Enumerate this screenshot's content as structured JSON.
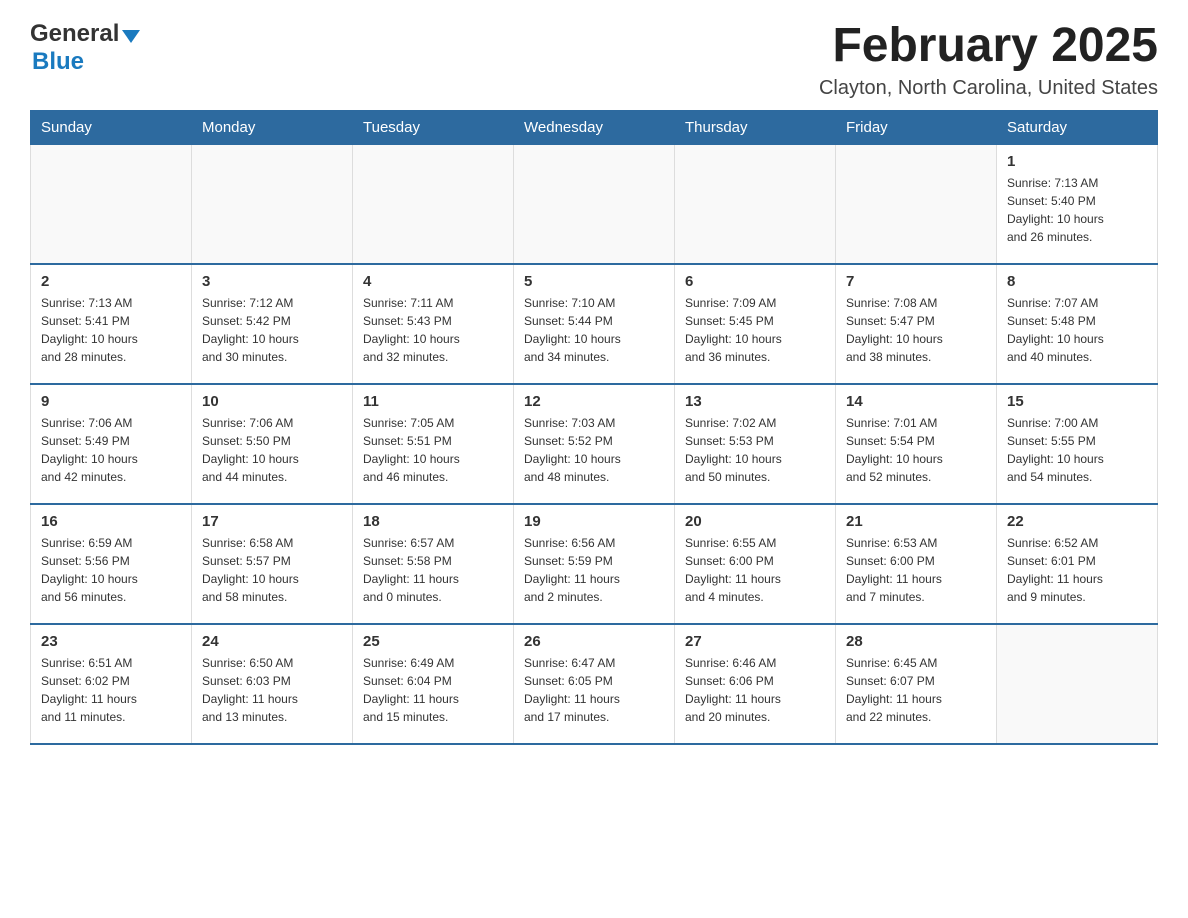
{
  "logo": {
    "general": "General",
    "blue": "Blue"
  },
  "header": {
    "month_title": "February 2025",
    "location": "Clayton, North Carolina, United States"
  },
  "weekdays": [
    "Sunday",
    "Monday",
    "Tuesday",
    "Wednesday",
    "Thursday",
    "Friday",
    "Saturday"
  ],
  "weeks": [
    [
      {
        "day": "",
        "info": ""
      },
      {
        "day": "",
        "info": ""
      },
      {
        "day": "",
        "info": ""
      },
      {
        "day": "",
        "info": ""
      },
      {
        "day": "",
        "info": ""
      },
      {
        "day": "",
        "info": ""
      },
      {
        "day": "1",
        "info": "Sunrise: 7:13 AM\nSunset: 5:40 PM\nDaylight: 10 hours\nand 26 minutes."
      }
    ],
    [
      {
        "day": "2",
        "info": "Sunrise: 7:13 AM\nSunset: 5:41 PM\nDaylight: 10 hours\nand 28 minutes."
      },
      {
        "day": "3",
        "info": "Sunrise: 7:12 AM\nSunset: 5:42 PM\nDaylight: 10 hours\nand 30 minutes."
      },
      {
        "day": "4",
        "info": "Sunrise: 7:11 AM\nSunset: 5:43 PM\nDaylight: 10 hours\nand 32 minutes."
      },
      {
        "day": "5",
        "info": "Sunrise: 7:10 AM\nSunset: 5:44 PM\nDaylight: 10 hours\nand 34 minutes."
      },
      {
        "day": "6",
        "info": "Sunrise: 7:09 AM\nSunset: 5:45 PM\nDaylight: 10 hours\nand 36 minutes."
      },
      {
        "day": "7",
        "info": "Sunrise: 7:08 AM\nSunset: 5:47 PM\nDaylight: 10 hours\nand 38 minutes."
      },
      {
        "day": "8",
        "info": "Sunrise: 7:07 AM\nSunset: 5:48 PM\nDaylight: 10 hours\nand 40 minutes."
      }
    ],
    [
      {
        "day": "9",
        "info": "Sunrise: 7:06 AM\nSunset: 5:49 PM\nDaylight: 10 hours\nand 42 minutes."
      },
      {
        "day": "10",
        "info": "Sunrise: 7:06 AM\nSunset: 5:50 PM\nDaylight: 10 hours\nand 44 minutes."
      },
      {
        "day": "11",
        "info": "Sunrise: 7:05 AM\nSunset: 5:51 PM\nDaylight: 10 hours\nand 46 minutes."
      },
      {
        "day": "12",
        "info": "Sunrise: 7:03 AM\nSunset: 5:52 PM\nDaylight: 10 hours\nand 48 minutes."
      },
      {
        "day": "13",
        "info": "Sunrise: 7:02 AM\nSunset: 5:53 PM\nDaylight: 10 hours\nand 50 minutes."
      },
      {
        "day": "14",
        "info": "Sunrise: 7:01 AM\nSunset: 5:54 PM\nDaylight: 10 hours\nand 52 minutes."
      },
      {
        "day": "15",
        "info": "Sunrise: 7:00 AM\nSunset: 5:55 PM\nDaylight: 10 hours\nand 54 minutes."
      }
    ],
    [
      {
        "day": "16",
        "info": "Sunrise: 6:59 AM\nSunset: 5:56 PM\nDaylight: 10 hours\nand 56 minutes."
      },
      {
        "day": "17",
        "info": "Sunrise: 6:58 AM\nSunset: 5:57 PM\nDaylight: 10 hours\nand 58 minutes."
      },
      {
        "day": "18",
        "info": "Sunrise: 6:57 AM\nSunset: 5:58 PM\nDaylight: 11 hours\nand 0 minutes."
      },
      {
        "day": "19",
        "info": "Sunrise: 6:56 AM\nSunset: 5:59 PM\nDaylight: 11 hours\nand 2 minutes."
      },
      {
        "day": "20",
        "info": "Sunrise: 6:55 AM\nSunset: 6:00 PM\nDaylight: 11 hours\nand 4 minutes."
      },
      {
        "day": "21",
        "info": "Sunrise: 6:53 AM\nSunset: 6:00 PM\nDaylight: 11 hours\nand 7 minutes."
      },
      {
        "day": "22",
        "info": "Sunrise: 6:52 AM\nSunset: 6:01 PM\nDaylight: 11 hours\nand 9 minutes."
      }
    ],
    [
      {
        "day": "23",
        "info": "Sunrise: 6:51 AM\nSunset: 6:02 PM\nDaylight: 11 hours\nand 11 minutes."
      },
      {
        "day": "24",
        "info": "Sunrise: 6:50 AM\nSunset: 6:03 PM\nDaylight: 11 hours\nand 13 minutes."
      },
      {
        "day": "25",
        "info": "Sunrise: 6:49 AM\nSunset: 6:04 PM\nDaylight: 11 hours\nand 15 minutes."
      },
      {
        "day": "26",
        "info": "Sunrise: 6:47 AM\nSunset: 6:05 PM\nDaylight: 11 hours\nand 17 minutes."
      },
      {
        "day": "27",
        "info": "Sunrise: 6:46 AM\nSunset: 6:06 PM\nDaylight: 11 hours\nand 20 minutes."
      },
      {
        "day": "28",
        "info": "Sunrise: 6:45 AM\nSunset: 6:07 PM\nDaylight: 11 hours\nand 22 minutes."
      },
      {
        "day": "",
        "info": ""
      }
    ]
  ]
}
